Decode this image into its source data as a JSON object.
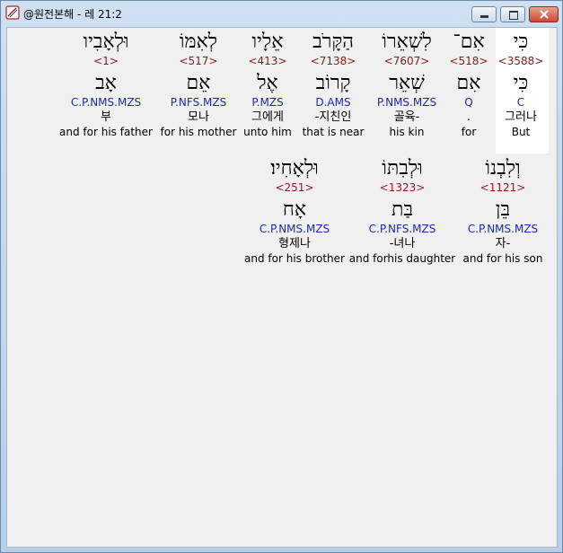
{
  "window": {
    "title": "@원전본해 - 레 21:2",
    "icon": "app-scroll-icon",
    "buttons": [
      "minimize-icon",
      "maximize-icon",
      "close-icon"
    ]
  },
  "colors": {
    "strong": "#8b1a1a",
    "parse": "#1a2ba8",
    "highlight_bg": "#ffffff"
  },
  "row1": [
    {
      "hebrew": "כִּי",
      "strong": "<3588>",
      "root": "כִּי",
      "parse": "C",
      "korean": "그러나",
      "english": "But"
    },
    {
      "hebrew": "אִם־",
      "strong": "<518>",
      "root": "אִם",
      "parse": "Q",
      "korean": ".",
      "english": "for"
    },
    {
      "hebrew": "לִשְׁאֵרוֹ",
      "strong": "<7607>",
      "root": "שְׁאֵר",
      "parse": "P.NMS.MZS",
      "korean": "골육-",
      "english": "his kin"
    },
    {
      "hebrew": "הַקָּרֹב",
      "strong": "<7138>",
      "root": "קָרוֹב",
      "parse": "D.AMS",
      "korean": "-지친인",
      "english": "that is near"
    },
    {
      "hebrew": "אֵלָיו",
      "strong": "<413>",
      "root": "אֶל",
      "parse": "P.MZS",
      "korean": "그에게",
      "english": "unto him"
    },
    {
      "hebrew": "לְאִמּוֹ",
      "strong": "<517>",
      "root": "אֵם",
      "parse": "P.NFS.MZS",
      "korean": "모나",
      "english": "for his mother"
    },
    {
      "hebrew": "וּלְאָבִיו",
      "strong": "<1>",
      "root": "אָב",
      "parse": "C.P.NMS.MZS",
      "korean": "부",
      "english": "and for his father"
    }
  ],
  "row2": [
    {
      "hebrew": "וְלִבְנוֹ",
      "strong": "<1121>",
      "root": "בֵּן",
      "parse": "C.P.NMS.MZS",
      "korean": "자-",
      "english": "and for his son"
    },
    {
      "hebrew": "וּלְבִתּוֹ",
      "strong": "<1323>",
      "root": "בַּת",
      "parse": "C.P.NFS.MZS",
      "korean": "-녀나",
      "english": "and forhis daughter"
    },
    {
      "hebrew": "וּלְאָחִיו׃",
      "strong": "<251>",
      "root": "אָח",
      "parse": "C.P.NMS.MZS",
      "korean": "형제나",
      "english": "and for his brother"
    }
  ]
}
